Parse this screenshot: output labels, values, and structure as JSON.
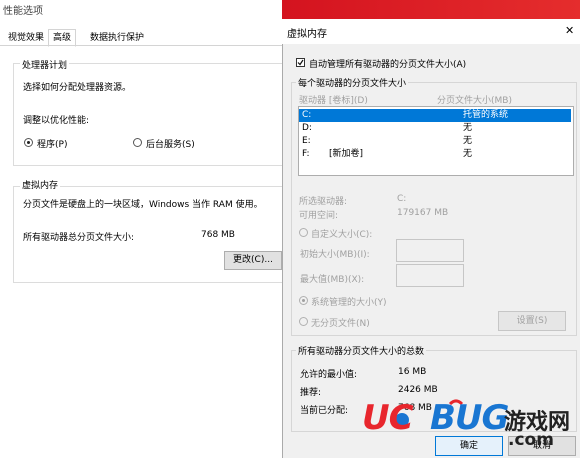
{
  "perf_window": {
    "title": "性能选项",
    "tabs": [
      {
        "label": "视觉效果"
      },
      {
        "label": "高级"
      },
      {
        "label": "数据执行保护"
      }
    ],
    "processor": {
      "heading": "处理器计划",
      "description": "选择如何分配处理器资源。",
      "optimize_label": "调整以优化性能:",
      "radio_programs": "程序(P)",
      "radio_services": "后台服务(S)"
    },
    "virtual_memory": {
      "heading": "虚拟内存",
      "description": "分页文件是硬盘上的一块区域，Windows 当作 RAM 使用。",
      "total_label": "所有驱动器总分页文件大小:",
      "total_value": "768 MB",
      "change_button": "更改(C)..."
    }
  },
  "vm_dialog": {
    "title": "虚拟内存",
    "auto_manage_label": "自动管理所有驱动器的分页文件大小(A)",
    "auto_manage_checked": true,
    "per_drive_heading": "每个驱动器的分页文件大小",
    "col_drive": "驱动器 [卷标](D)",
    "col_size": "分页文件大小(MB)",
    "drives": [
      {
        "drive": "C:",
        "label": "",
        "size": "托管的系统",
        "selected": true
      },
      {
        "drive": "D:",
        "label": "",
        "size": "无",
        "selected": false
      },
      {
        "drive": "E:",
        "label": "",
        "size": "无",
        "selected": false
      },
      {
        "drive": "F:",
        "label": "[新加卷]",
        "size": "无",
        "selected": false
      }
    ],
    "selected_drive_label": "所选驱动器:",
    "selected_drive_value": "C:",
    "free_space_label": "可用空间:",
    "free_space_value": "179167 MB",
    "custom_size_label": "自定义大小(C):",
    "initial_size_label": "初始大小(MB)(I):",
    "max_size_label": "最大值(MB)(X):",
    "system_managed_label": "系统管理的大小(Y)",
    "no_paging_label": "无分页文件(N)",
    "set_button": "设置(S)",
    "totals_heading": "所有驱动器分页文件大小的总数",
    "min_allowed_label": "允许的最小值:",
    "min_allowed_value": "16 MB",
    "recommended_label": "推荐:",
    "recommended_value": "2426 MB",
    "current_label": "当前已分配:",
    "current_value": "768 MB",
    "ok_button": "确定",
    "cancel_button": "取消",
    "close_glyph": "✕"
  },
  "watermark": {
    "brand_uc": "UC",
    "brand_bug": "BUG",
    "brand_cn": "游戏网",
    "domain": ".com"
  },
  "colors": {
    "selection_blue": "#0078d7",
    "watermark_red": "#e8262d",
    "watermark_blue": "#1976d2"
  }
}
